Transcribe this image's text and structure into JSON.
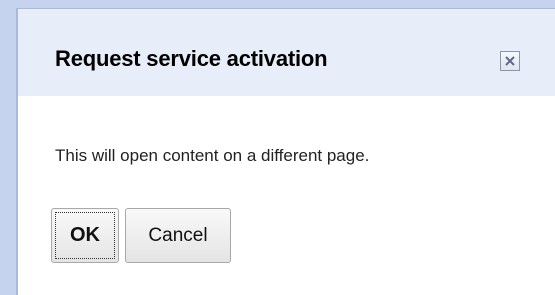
{
  "dialog": {
    "title": "Request service activation",
    "message": "This will open content on a different page.",
    "close_icon": "close-icon",
    "buttons": {
      "ok_label": "OK",
      "cancel_label": "Cancel"
    }
  },
  "colors": {
    "frame": "#c5d3ee",
    "title_bar": "#e8eef9",
    "background": "#ffffff"
  }
}
